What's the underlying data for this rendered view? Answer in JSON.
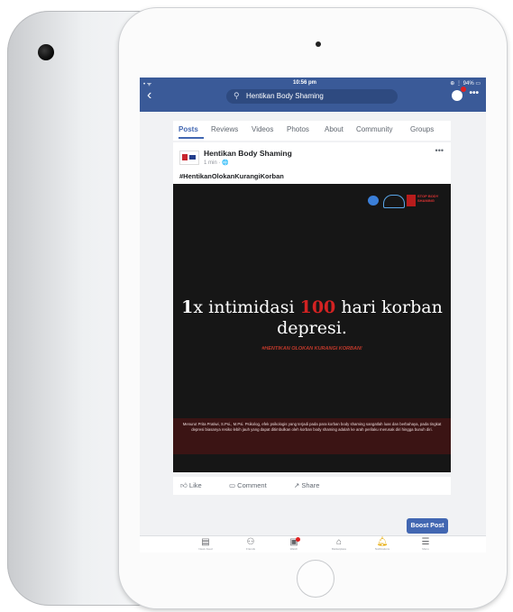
{
  "status_bar": {
    "left": "• ᯤ",
    "time": "10:56 pm",
    "right": "⊕ ⋮ 94% ▭"
  },
  "nav": {
    "back_icon": "chevron-left-icon",
    "search_value": "Hentikan Body Shaming",
    "more": "•••"
  },
  "tabs": [
    {
      "label": "Posts",
      "active": true
    },
    {
      "label": "Reviews"
    },
    {
      "label": "Videos"
    },
    {
      "label": "Photos"
    },
    {
      "label": "About"
    },
    {
      "label": "Community"
    },
    {
      "label": "Groups"
    }
  ],
  "post": {
    "author": "Hentikan Body Shaming",
    "time": "1 min · 🌐",
    "more": "•••",
    "hashtag": "#HentikanOlokanKurangiKorban",
    "image": {
      "logo_text": "STOP BODY SHAMING",
      "headline_num1": "1",
      "headline_a": "x intimidasi ",
      "headline_num2": "100",
      "headline_b": " hari korban",
      "headline_line2": "depresi.",
      "subhead": "#HENTIKAN OLOKAN KURANGI KORBAN!",
      "caption": "Menurut Prita Pratiwi, S.Psi., M.Psi. Psikolog, efek psikologis yang terjadi pada para korban body shaming sangatlah luas dan berbahaya, pada tingkat depresi biasanya resiko lebih jauh yang dapat ditimbulkan oleh korban body shaming adalah ke arah perilaku merusak diri hingga bunuh diri."
    },
    "actions": [
      {
        "label": "Like",
        "icon": "thumbs-up-icon"
      },
      {
        "label": "Comment",
        "icon": "comment-icon"
      },
      {
        "label": "Share",
        "icon": "share-icon"
      }
    ],
    "boost_label": "Boost Post"
  },
  "bottom_nav": [
    {
      "label": "News Feed",
      "icon": "news-feed-icon"
    },
    {
      "label": "Friends",
      "icon": "friends-icon"
    },
    {
      "label": "Watch",
      "icon": "watch-icon"
    },
    {
      "label": "Marketplace",
      "icon": "marketplace-icon"
    },
    {
      "label": "Notifications",
      "icon": "bell-icon"
    },
    {
      "label": "Menu",
      "icon": "menu-icon"
    }
  ],
  "colors": {
    "fb_blue": "#3a5a98",
    "accent_red": "#d32222",
    "image_bg": "#161616"
  }
}
